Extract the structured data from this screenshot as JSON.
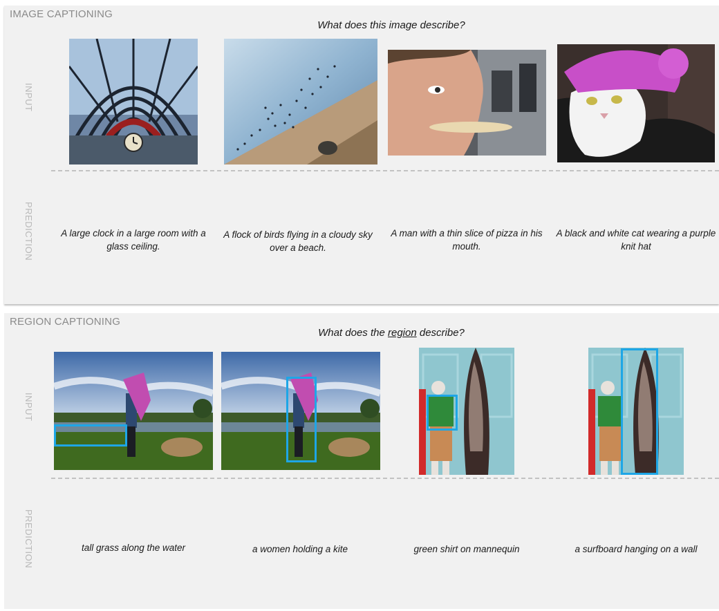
{
  "image_captioning": {
    "title": "IMAGE CAPTIONING",
    "question": "What does this image describe?",
    "input_label": "INPUT",
    "prediction_label": "PREDICTION",
    "items": [
      {
        "image": "clock-hall-photo",
        "caption": "A large clock in a large room with a glass ceiling."
      },
      {
        "image": "birds-beach-photo",
        "caption": "A flock of birds flying in a cloudy sky over a beach."
      },
      {
        "image": "man-pizza-photo",
        "caption": "A man with a thin slice of pizza in his mouth."
      },
      {
        "image": "cat-hat-photo",
        "caption": "A black and white cat wearing a purple knit hat"
      }
    ]
  },
  "region_captioning": {
    "title": "REGION CAPTIONING",
    "question_before": "What does the ",
    "question_underlined": "region",
    "question_after": " describe?",
    "input_label": "INPUT",
    "prediction_label": "PREDICTION",
    "items": [
      {
        "image": "kite-field-photo",
        "caption": "tall grass along the water"
      },
      {
        "image": "kite-field-photo",
        "caption": "a women holding a kite"
      },
      {
        "image": "mannequin-surfboard-photo",
        "caption": "green shirt on mannequin"
      },
      {
        "image": "mannequin-surfboard-photo",
        "caption": "a surfboard hanging on a wall"
      }
    ],
    "box_color": "#1ea6e6"
  }
}
